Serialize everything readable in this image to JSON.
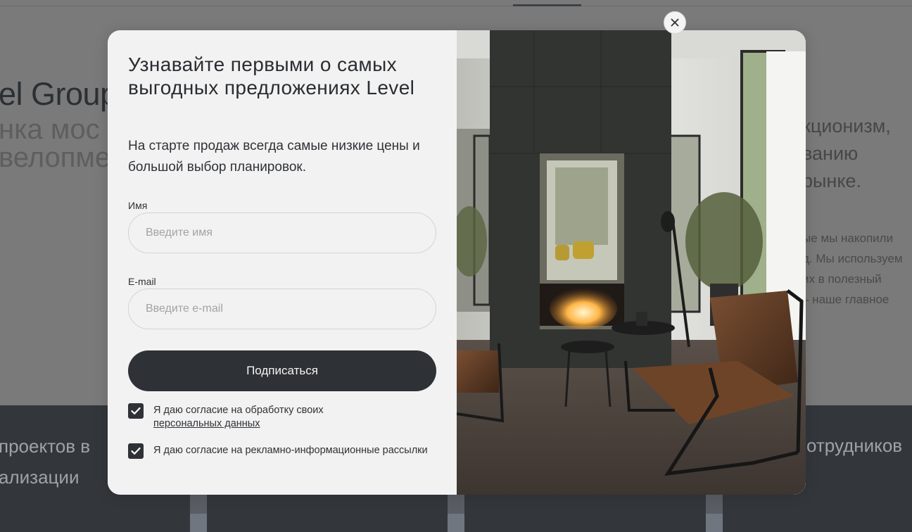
{
  "background": {
    "heading": "el Group",
    "subtitle_lines": [
      "нка мос",
      "велопме"
    ],
    "right_lines": [
      "кционизм,",
      "ванию",
      "рынке."
    ],
    "right_small_lines": [
      "ые мы накопили",
      "д. Мы используем",
      "их в полезный",
      "– наше главное"
    ],
    "bottom_left_lines": [
      "проектов в",
      "ализации"
    ],
    "bottom_right": "отрудников"
  },
  "modal": {
    "title": "Узнавайте первыми о самых выгодных предложениях Level",
    "description": "На старте продаж всегда самые низкие цены и большой выбор планировок.",
    "name_field": {
      "label": "Имя",
      "placeholder": "Введите имя",
      "value": ""
    },
    "email_field": {
      "label": "E-mail",
      "placeholder": "Введите e-mail",
      "value": ""
    },
    "submit_label": "Подписаться",
    "consent_personal": {
      "text": "Я даю согласие на обработку своих",
      "link_text": "персональных данных",
      "checked": true
    },
    "consent_marketing": {
      "text": "Я даю согласие на рекламно-информационные рассылки",
      "checked": true
    },
    "image_icon": "interior-photo-fireplace",
    "close_icon": "close-icon"
  },
  "colors": {
    "overlay_bg": "#7a7a7a",
    "modal_bg": "#f2f2f2",
    "button_dark": "#2e3135",
    "footer_dark": "#33373c"
  }
}
